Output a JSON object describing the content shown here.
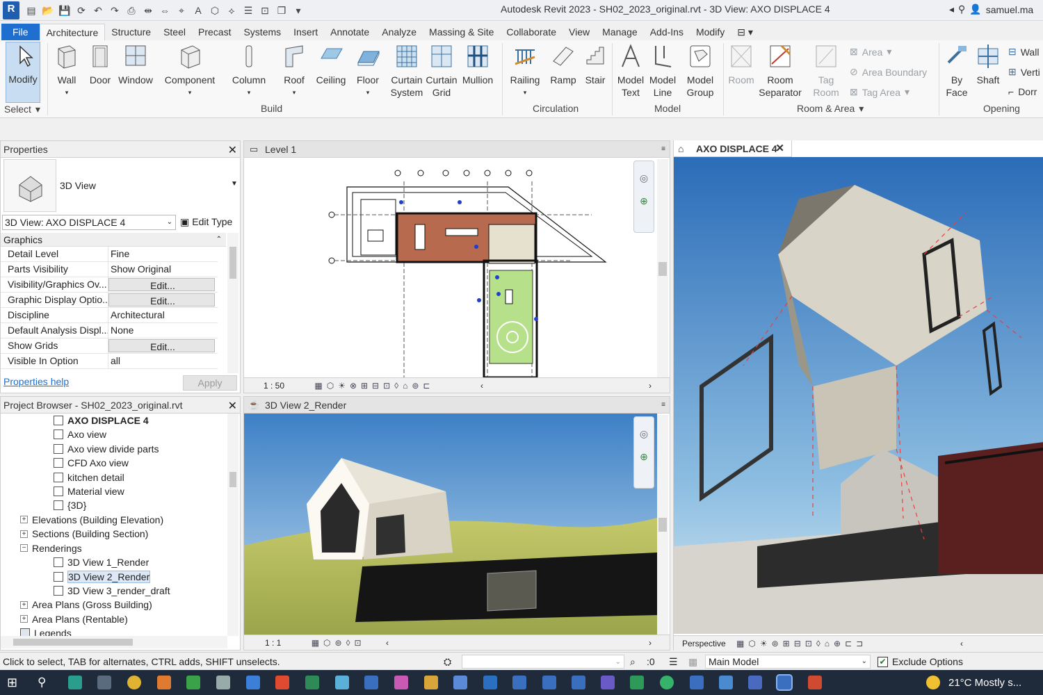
{
  "app": {
    "title": "Autodesk Revit 2023 - SH02_2023_original.rvt - 3D View: AXO DISPLACE 4",
    "user": "samuel.ma"
  },
  "tabs": [
    "File",
    "Architecture",
    "Structure",
    "Steel",
    "Precast",
    "Systems",
    "Insert",
    "Annotate",
    "Analyze",
    "Massing & Site",
    "Collaborate",
    "View",
    "Manage",
    "Add-Ins",
    "Modify"
  ],
  "active_tab": "Architecture",
  "ribbon": {
    "modify": "Modify",
    "select": "Select",
    "wall": "Wall",
    "door": "Door",
    "window": "Window",
    "component": "Component",
    "column": "Column",
    "roof": "Roof",
    "ceiling": "Ceiling",
    "floor": "Floor",
    "curtain_system": [
      "Curtain",
      "System"
    ],
    "curtain_grid": [
      "Curtain",
      "Grid"
    ],
    "mullion": "Mullion",
    "build": "Build",
    "railing": "Railing",
    "ramp": "Ramp",
    "stair": "Stair",
    "circulation": "Circulation",
    "model_text": [
      "Model",
      "Text"
    ],
    "model_line": [
      "Model",
      "Line"
    ],
    "model_group": [
      "Model",
      "Group"
    ],
    "model": "Model",
    "room": "Room",
    "room_separator": [
      "Room",
      "Separator"
    ],
    "tag_room": [
      "Tag",
      "Room"
    ],
    "area": "Area",
    "area_boundary": "Area  Boundary",
    "tag_area": "Tag  Area",
    "room_area": "Room & Area",
    "by_face": [
      "By",
      "Face"
    ],
    "shaft": "Shaft",
    "wall_opening": "Wall",
    "vertical": "Verti",
    "dormer": "Dorr",
    "opening": "Opening"
  },
  "properties": {
    "title": "Properties",
    "type_name": "3D View",
    "instance": "3D View: AXO DISPLACE 4",
    "edit_type": "Edit Type",
    "section": "Graphics",
    "rows": [
      {
        "k": "Detail Level",
        "v": "Fine",
        "btn": false
      },
      {
        "k": "Parts Visibility",
        "v": "Show Original",
        "btn": false
      },
      {
        "k": "Visibility/Graphics Ov...",
        "v": "Edit...",
        "btn": true
      },
      {
        "k": "Graphic Display Optio...",
        "v": "Edit...",
        "btn": true
      },
      {
        "k": "Discipline",
        "v": "Architectural",
        "btn": false
      },
      {
        "k": "Default Analysis Displ...",
        "v": "None",
        "btn": false
      },
      {
        "k": "Show Grids",
        "v": "Edit...",
        "btn": true
      },
      {
        "k": "Visible In Option",
        "v": "all",
        "btn": false
      }
    ],
    "help": "Properties help",
    "apply": "Apply"
  },
  "browser": {
    "title": "Project Browser - SH02_2023_original.rvt",
    "items": [
      {
        "label": "AXO DISPLACE 4",
        "kind": "view",
        "bold": true
      },
      {
        "label": "Axo view",
        "kind": "view"
      },
      {
        "label": "Axo view divide parts",
        "kind": "view"
      },
      {
        "label": "CFD Axo view",
        "kind": "view"
      },
      {
        "label": "kitchen detail",
        "kind": "view"
      },
      {
        "label": "Material view",
        "kind": "view"
      },
      {
        "label": "{3D}",
        "kind": "view"
      },
      {
        "label": "Elevations (Building Elevation)",
        "kind": "group"
      },
      {
        "label": "Sections (Building Section)",
        "kind": "group"
      },
      {
        "label": "Renderings",
        "kind": "open"
      },
      {
        "label": "3D View 1_Render",
        "kind": "view"
      },
      {
        "label": "3D View 2_Render",
        "kind": "view",
        "selected": true
      },
      {
        "label": "3D View 3_render_draft",
        "kind": "view"
      },
      {
        "label": "Area Plans (Gross Building)",
        "kind": "group"
      },
      {
        "label": "Area Plans (Rentable)",
        "kind": "group"
      },
      {
        "label": "Legends",
        "kind": "legend"
      }
    ]
  },
  "views": {
    "plan": {
      "title": "Level 1",
      "scale": "1 : 50"
    },
    "render": {
      "title": "3D View 2_Render",
      "scale": "1 : 1"
    },
    "axo": {
      "title": "AXO DISPLACE 4",
      "mode": "Perspective"
    }
  },
  "status": {
    "hint": "Click to select, TAB for alternates, CTRL adds, SHIFT unselects.",
    "count": ":0",
    "model": "Main Model",
    "exclude": "Exclude Options"
  },
  "taskbar": {
    "weather": "21°C  Mostly s..."
  }
}
